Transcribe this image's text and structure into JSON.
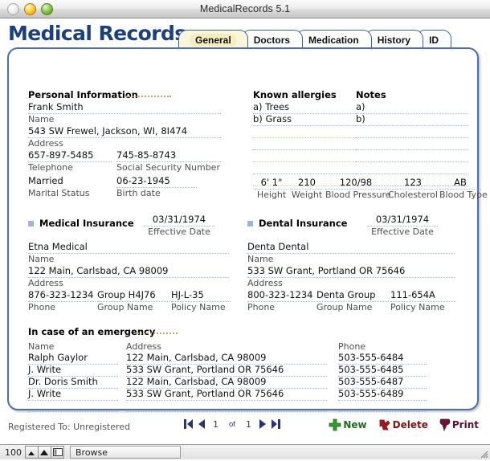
{
  "window": {
    "title": "MedicalRecords 5.1",
    "buttons": {
      "close": "close-button",
      "minimize": "minimize-button",
      "zoom": "zoom-button"
    }
  },
  "header": {
    "logo": "Medical Records",
    "tabs": [
      {
        "label": "General",
        "active": true
      },
      {
        "label": "Doctors",
        "active": false
      },
      {
        "label": "Medication",
        "active": false
      },
      {
        "label": "History",
        "active": false
      },
      {
        "label": "ID",
        "active": false
      }
    ]
  },
  "personal": {
    "heading": "Personal Information",
    "name": {
      "value": "Frank Smith",
      "label": "Name"
    },
    "address": {
      "value": "543 SW Frewel, Jackson, WI, 8I474",
      "label": "Address"
    },
    "telephone": {
      "value": "657-897-5485",
      "label": "Telephone"
    },
    "ssn": {
      "value": "745-85-8743",
      "label": "Social Security Number"
    },
    "marital_status": {
      "value": "Married",
      "label": "Marital Status"
    },
    "birth_date": {
      "value": "06-23-1945",
      "label": "Birth date"
    }
  },
  "allergies": {
    "heading": "Known allergies",
    "items": [
      "a) Trees",
      "b) Grass"
    ]
  },
  "notes": {
    "heading": "Notes",
    "items": [
      "a)",
      "b)"
    ]
  },
  "vitals": [
    {
      "value": "6' 1\"",
      "label": "Height"
    },
    {
      "value": "210",
      "label": "Weight"
    },
    {
      "value": "120/98",
      "label": "Blood Pressure"
    },
    {
      "value": "123",
      "label": "Cholesterol"
    },
    {
      "value": "AB",
      "label": "Blood Type"
    }
  ],
  "medical_insurance": {
    "heading": "Medical Insurance",
    "effective_date": {
      "value": "03/31/1974",
      "label": "Effective Date"
    },
    "name": {
      "value": "Etna Medical",
      "label": "Name"
    },
    "address": {
      "value": "122 Main, Carlsbad, CA 98009",
      "label": "Address"
    },
    "phone": {
      "value": "876-323-1234",
      "label": "Phone"
    },
    "group": {
      "value": "Group H4J76",
      "label": "Group Name"
    },
    "policy": {
      "value": "HJ-L-35",
      "label": "Policy Name"
    }
  },
  "dental_insurance": {
    "heading": "Dental Insurance",
    "effective_date": {
      "value": "03/31/1974",
      "label": "Effective Date"
    },
    "name": {
      "value": "Denta Dental",
      "label": "Name"
    },
    "address": {
      "value": "533 SW Grant, Portland OR 75646",
      "label": "Address"
    },
    "phone": {
      "value": "800-323-1234",
      "label": "Phone"
    },
    "group": {
      "value": "Denta Group",
      "label": "Group Name"
    },
    "policy": {
      "value": "111-654A",
      "label": "Policy Name"
    }
  },
  "emergency": {
    "heading": "In case of an emergency",
    "columns": [
      "Name",
      "Address",
      "Phone"
    ],
    "rows": [
      {
        "name": "Ralph Gaylor",
        "address": "122 Main, Carlsbad, CA 98009",
        "phone": "503-555-6484"
      },
      {
        "name": "J. Write",
        "address": "533 SW Grant, Portland OR 75646",
        "phone": "503-555-6485"
      },
      {
        "name": "Dr. Doris Smith",
        "address": "122 Main, Carlsbad, CA 98009",
        "phone": "503-555-6487"
      },
      {
        "name": "J. Write",
        "address": "533 SW Grant, Portland OR 75646",
        "phone": "503-555-6489"
      },
      {
        "name": "",
        "address": "",
        "phone": ""
      }
    ]
  },
  "toolbar": {
    "registered": "Registered To: Unregistered",
    "nav": {
      "current_record": "1",
      "of": "of",
      "total_records": "1"
    },
    "actions": [
      {
        "label": "New",
        "icon": "plus-icon",
        "color": "#1d6b1d"
      },
      {
        "label": "Delete",
        "icon": "delete-icon",
        "color": "#7d1212"
      },
      {
        "label": "Print",
        "icon": "print-icon",
        "color": "#5c1030"
      }
    ]
  },
  "statusbar": {
    "zoom_level": "100",
    "mode": "Browse"
  }
}
